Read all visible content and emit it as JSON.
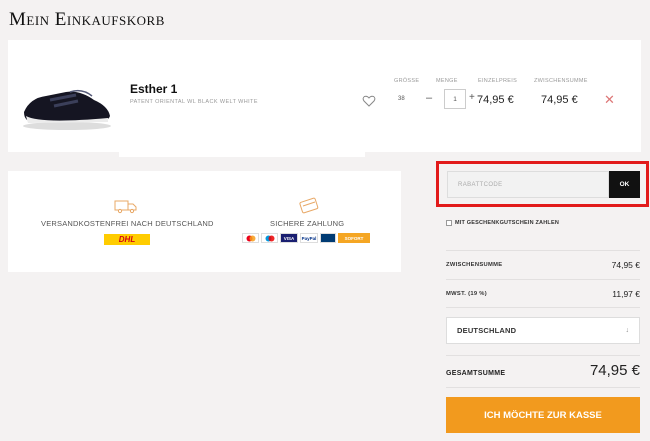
{
  "page": {
    "title": "Mein Einkaufskorb"
  },
  "cart": {
    "headers": {
      "size": "GRÖSSE",
      "quantity": "MENGE",
      "unit_price": "EINZELPREIS",
      "subtotal": "ZWISCHENSUMME"
    },
    "item": {
      "name": "Esther 1",
      "variant": "PATENT ORIENTAL WL BLACK WELT WHITE",
      "size": "38",
      "quantity": "1",
      "minus": "–",
      "plus": "+",
      "unit_price": "74,95 €",
      "subtotal": "74,95 €",
      "remove": "✕"
    }
  },
  "info": {
    "shipping": {
      "text": "VERSANDKOSTENFREI NACH DEUTSCHLAND",
      "carrier": "DHL"
    },
    "payment": {
      "text": "SICHERE ZAHLUNG",
      "methods": [
        "",
        "",
        "VISA",
        "PayPal",
        "",
        "SOFORT"
      ]
    }
  },
  "coupon": {
    "placeholder": "RABATTCODE",
    "button": "OK"
  },
  "gift": {
    "label": "MIT GESCHENKGUTSCHEIN ZAHLEN"
  },
  "summary": {
    "subtotal_label": "ZWISCHENSUMME",
    "subtotal_value": "74,95 €",
    "vat_label": "MWST. (19 %)",
    "vat_value": "11,97 €",
    "country": "DEUTSCHLAND",
    "country_arrow": "↓",
    "total_label": "GESAMTSUMME",
    "total_value": "74,95 €",
    "checkout": "ICH MÖCHTE ZUR KASSE"
  },
  "colors": {
    "checkout": "#f29a1e",
    "highlight": "#e21b1b",
    "dhl_yellow": "#ffcc00",
    "dhl_red": "#d40511"
  }
}
